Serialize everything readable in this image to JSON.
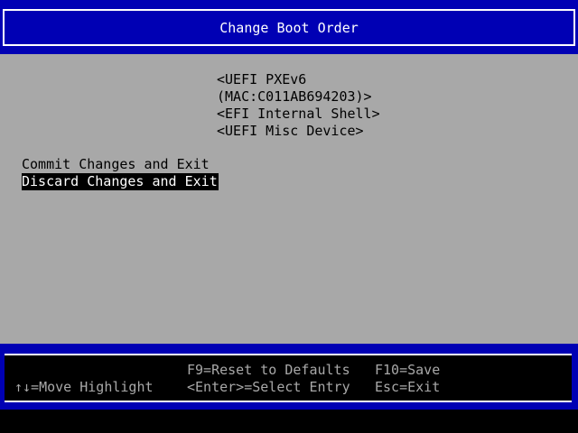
{
  "header": {
    "title": "Change Boot Order"
  },
  "boot_order": {
    "items": [
      "<UEFI PXEv6",
      "(MAC:C011AB694203)>",
      "<EFI Internal Shell>",
      "<UEFI Misc Device>"
    ]
  },
  "actions": {
    "commit_label": "Commit Changes and Exit",
    "discard_label": "Discard Changes and Exit",
    "highlighted": "Discard Changes and Exit"
  },
  "footer": {
    "move_highlight": "↑↓=Move Highlight",
    "reset_defaults": "F9=Reset to Defaults",
    "select_entry": "<Enter>=Select Entry",
    "save": "F10=Save",
    "exit": "Esc=Exit"
  },
  "colors": {
    "header_blue": "#0000b4",
    "content_gray": "#a8a8a8",
    "highlight_bg": "#000000",
    "highlight_fg": "#ffffff"
  }
}
